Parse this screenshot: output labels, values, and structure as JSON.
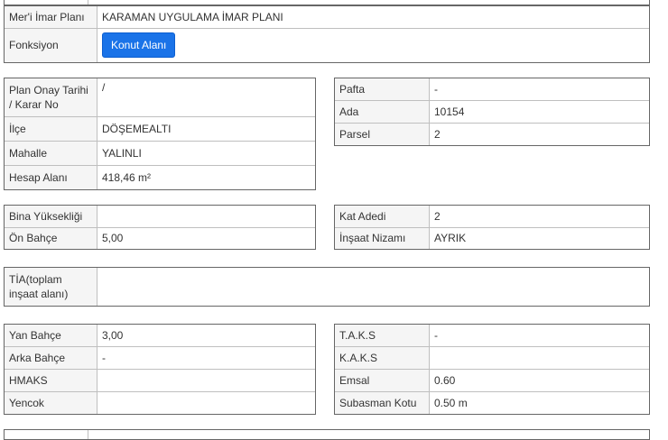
{
  "plan_info": {
    "plan_label": "Mer'i İmar Planı",
    "plan_value": "KARAMAN UYGULAMA İMAR PLANI",
    "function_label": "Fonksiyon",
    "function_button": "Konut Alanı"
  },
  "location": {
    "approval_label": "Plan Onay Tarihi / Karar No",
    "approval_value": "/",
    "district_label": "İlçe",
    "district_value": "DÖŞEMEALTI",
    "neighborhood_label": "Mahalle",
    "neighborhood_value": "YALINLI",
    "area_label": "Hesap Alanı",
    "area_value": "418,46 m²"
  },
  "parcel": {
    "sheet_label": "Pafta",
    "sheet_value": "-",
    "block_label": "Ada",
    "block_value": "10154",
    "parcel_label": "Parsel",
    "parcel_value": "2"
  },
  "building": {
    "height_label": "Bina Yüksekliği",
    "height_value": "",
    "front_yard_label": "Ön Bahçe",
    "front_yard_value": "5,00",
    "floors_label": "Kat Adedi",
    "floors_value": "2",
    "order_label": "İnşaat Nizamı",
    "order_value": "AYRIK"
  },
  "tia": {
    "label": "TİA(toplam inşaat alanı)",
    "value": ""
  },
  "yards": {
    "side_label": "Yan Bahçe",
    "side_value": "3,00",
    "rear_label": "Arka Bahçe",
    "rear_value": "-",
    "hmaks_label": "HMAKS",
    "hmaks_value": "",
    "yencok_label": "Yencok",
    "yencok_value": ""
  },
  "ratios": {
    "taks_label": "T.A.K.S",
    "taks_value": "-",
    "kaks_label": "K.A.K.S",
    "kaks_value": "",
    "emsal_label": "Emsal",
    "emsal_value": "0.60",
    "subasman_label": "Subasman Kotu",
    "subasman_value": "0.50 m"
  }
}
